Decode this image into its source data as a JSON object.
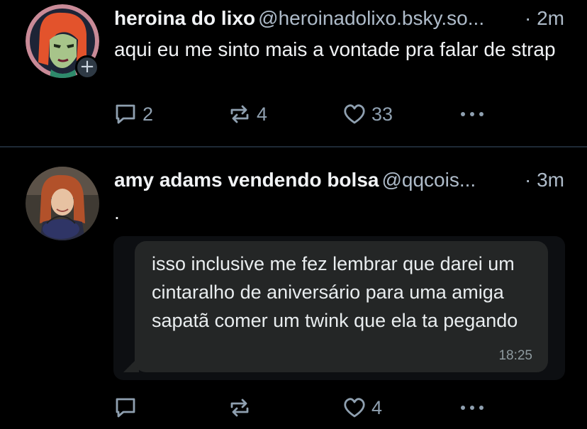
{
  "posts": [
    {
      "display_name": "heroina do lixo",
      "handle": "@heroinadolixo.bsky.so...",
      "time": "· 2m",
      "text": "aqui eu me sinto mais a vontade pra falar de strap",
      "follow_badge": "+",
      "counts": {
        "replies": "2",
        "reposts": "4",
        "likes": "33"
      }
    },
    {
      "display_name": "amy adams vendendo bolsa",
      "handle": "@qqcois...",
      "time": "· 3m",
      "text": ".",
      "embed": {
        "message": "isso inclusive me fez lembrar que darei um cintaralho de aniversário para uma amiga sapatã comer um twink que ela ta pegando",
        "time": "18:25"
      },
      "counts": {
        "likes": "4"
      }
    }
  ],
  "colors": {
    "background": "#000000",
    "text": "#f1f3f5",
    "muted": "#aebbc9",
    "icon": "#8fa0b0",
    "divider": "#1e2936",
    "bubble": "#242626"
  },
  "icons": [
    "reply-icon",
    "repost-icon",
    "like-icon",
    "more-icon",
    "plus-icon"
  ]
}
